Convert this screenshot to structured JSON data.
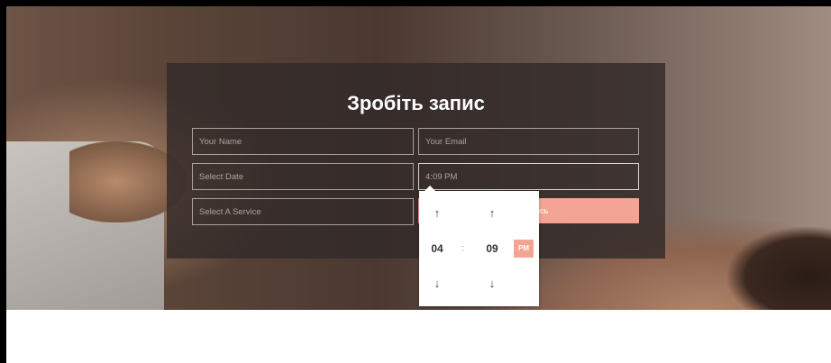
{
  "form": {
    "title": "Зробіть запис",
    "name_placeholder": "Your Name",
    "email_placeholder": "Your Email",
    "date_placeholder": "Select Date",
    "time_value": "4:09 PM",
    "service_placeholder": "Select A Service",
    "submit_label": "ись"
  },
  "time_picker": {
    "hour": "04",
    "separator": ":",
    "minute": "09",
    "period": "PM",
    "up_icon": "↑",
    "down_icon": "↓"
  },
  "colors": {
    "accent": "#f5a394",
    "overlay": "#322a28"
  }
}
